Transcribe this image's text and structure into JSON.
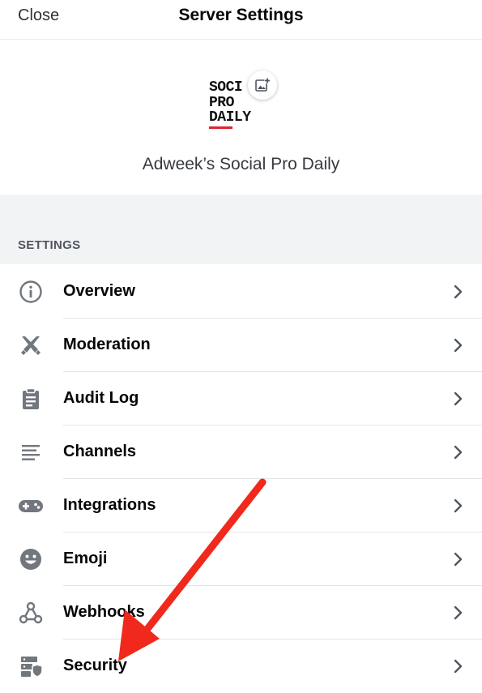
{
  "header": {
    "close_label": "Close",
    "title": "Server Settings"
  },
  "server": {
    "logo_lines": [
      "SOCI",
      "PRO",
      "DAILY"
    ],
    "name": "Adweek’s Social Pro Daily",
    "upload_icon": "image-plus-icon"
  },
  "settings": {
    "section_label": "SETTINGS",
    "items": [
      {
        "label": "Overview",
        "icon": "info-icon"
      },
      {
        "label": "Moderation",
        "icon": "crossed-swords-icon"
      },
      {
        "label": "Audit Log",
        "icon": "clipboard-icon"
      },
      {
        "label": "Channels",
        "icon": "list-lines-icon"
      },
      {
        "label": "Integrations",
        "icon": "gamepad-icon"
      },
      {
        "label": "Emoji",
        "icon": "smiley-icon"
      },
      {
        "label": "Webhooks",
        "icon": "webhook-icon"
      },
      {
        "label": "Security",
        "icon": "server-shield-icon"
      }
    ]
  },
  "colors": {
    "icon_gray": "#72767d",
    "annotation_arrow": "#f0291c",
    "logo_accent": "#e0232f"
  }
}
